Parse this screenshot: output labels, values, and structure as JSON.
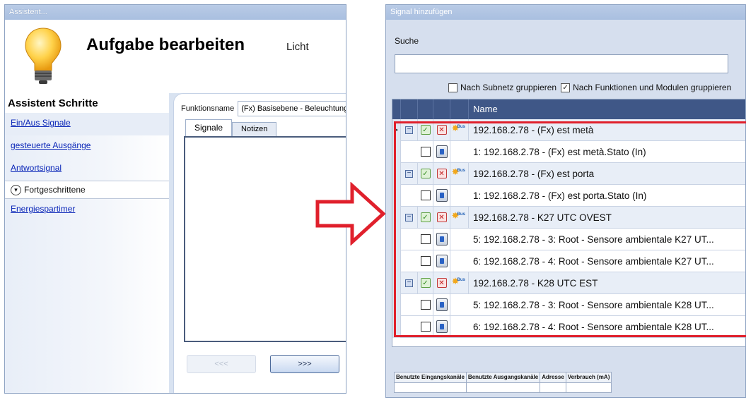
{
  "left_window": {
    "title": "Assistent...",
    "page_title": "Aufgabe bearbeiten",
    "page_subtitle": "Licht",
    "steps_title": "Assistent Schritte",
    "steps": [
      "Ein/Aus Signale",
      "gesteuerte Ausgänge",
      "Antwortsignal"
    ],
    "advanced_label": "Fortgeschrittene",
    "extra_step": "Energiespartimer",
    "function_label": "Funktionsname",
    "function_value": "(Fx) Basisebene - Beleuchtung",
    "tabs": [
      "Signale",
      "Notizen"
    ],
    "prev_button": "<<<",
    "next_button": ">>>"
  },
  "right_window": {
    "title": "Signal hinzufügen",
    "search_label": "Suche",
    "search_value": "",
    "group_subnet_label": "Nach Subnetz gruppieren",
    "group_subnet_checked": false,
    "group_function_label": "Nach Funktionen und Modulen gruppieren",
    "group_function_checked": true,
    "column_name": "Name",
    "rows": [
      {
        "type": "group",
        "name": "192.168.2.78 - (Fx) est metà",
        "current": true
      },
      {
        "type": "item",
        "name": "1: 192.168.2.78 - (Fx) est metà.Stato (In)"
      },
      {
        "type": "group",
        "name": "192.168.2.78 - (Fx) est porta"
      },
      {
        "type": "item",
        "name": "1: 192.168.2.78 - (Fx) est porta.Stato (In)"
      },
      {
        "type": "group",
        "name": "192.168.2.78 - K27 UTC OVEST"
      },
      {
        "type": "item",
        "name": "5: 192.168.2.78 - 3: Root - Sensore ambientale K27 UT..."
      },
      {
        "type": "item",
        "name": "6: 192.168.2.78 - 4: Root - Sensore ambientale K27 UT..."
      },
      {
        "type": "group",
        "name": "192.168.2.78 - K28 UTC EST"
      },
      {
        "type": "item",
        "name": "5: 192.168.2.78 - 3: Root - Sensore ambientale K28 UT..."
      },
      {
        "type": "item",
        "name": "6: 192.168.2.78 - 4: Root - Sensore ambientale K28 UT..."
      }
    ],
    "stats": [
      "Benutzte Eingangskanäle",
      "Benutzte Ausgangskanäle",
      "Adresse",
      "Verbrauch (mA)"
    ],
    "bus_icon_text": "Bus"
  },
  "colors": {
    "header_blue": "#3f5787",
    "highlight_red": "#e0202c",
    "arrow_red": "#e0202c",
    "link_blue": "#0a26b8"
  }
}
